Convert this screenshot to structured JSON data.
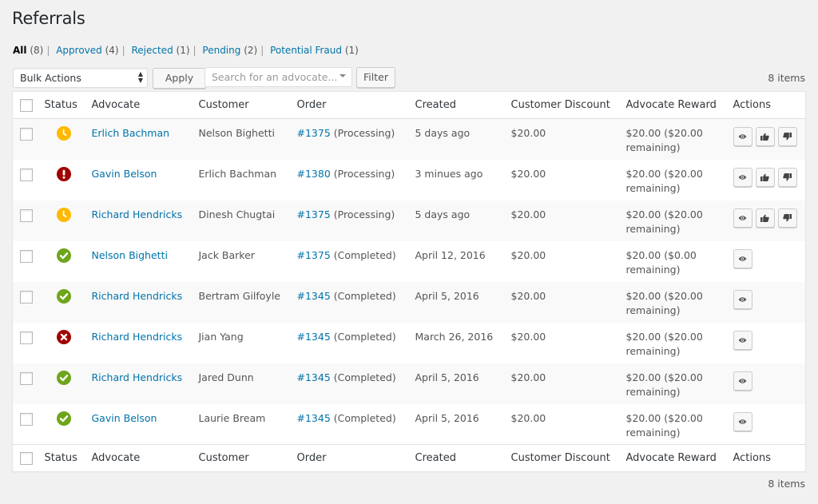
{
  "page": {
    "title": "Referrals"
  },
  "filters": [
    {
      "label": "All",
      "count": "(8)",
      "current": true
    },
    {
      "label": "Approved",
      "count": "(4)",
      "current": false
    },
    {
      "label": "Rejected",
      "count": "(1)",
      "current": false
    },
    {
      "label": "Pending",
      "count": "(2)",
      "current": false
    },
    {
      "label": "Potential Fraud",
      "count": "(1)",
      "current": false
    }
  ],
  "toolbar": {
    "bulk_actions": "Bulk Actions",
    "apply_label": "Apply",
    "search_placeholder": "Search for an advocate...",
    "filter_label": "Filter",
    "items_count": "8 items"
  },
  "columns": [
    "Status",
    "Advocate",
    "Customer",
    "Order",
    "Created",
    "Customer Discount",
    "Advocate Reward",
    "Actions"
  ],
  "status_colors": {
    "pending": "#ffb900",
    "fraud": "#a00000",
    "approved": "#6ea51b",
    "rejected": "#a00000"
  },
  "rows": [
    {
      "status": "pending",
      "advocate": "Erlich Bachman",
      "customer": "Nelson Bighetti",
      "order_number": "#1375",
      "order_status": "(Processing)",
      "created": "5 days ago",
      "discount": "$20.00",
      "reward": "$20.00 ($20.00 remaining)",
      "actions": [
        "view",
        "approve",
        "reject"
      ]
    },
    {
      "status": "fraud",
      "advocate": "Gavin Belson",
      "customer": "Erlich Bachman",
      "order_number": "#1380",
      "order_status": "(Processing)",
      "created": "3 minues ago",
      "discount": "$20.00",
      "reward": "$20.00 ($20.00 remaining)",
      "actions": [
        "view",
        "approve",
        "reject"
      ]
    },
    {
      "status": "pending",
      "advocate": "Richard Hendricks",
      "customer": "Dinesh Chugtai",
      "order_number": "#1375",
      "order_status": "(Processing)",
      "created": "5 days ago",
      "discount": "$20.00",
      "reward": "$20.00 ($20.00 remaining)",
      "actions": [
        "view",
        "approve",
        "reject"
      ]
    },
    {
      "status": "approved",
      "advocate": "Nelson Bighetti",
      "customer": "Jack Barker",
      "order_number": "#1375",
      "order_status": "(Completed)",
      "created": "April 12, 2016",
      "discount": "$20.00",
      "reward": "$20.00 ($0.00 remaining)",
      "actions": [
        "view"
      ]
    },
    {
      "status": "approved",
      "advocate": "Richard Hendricks",
      "customer": "Bertram Gilfoyle",
      "order_number": "#1345",
      "order_status": "(Completed)",
      "created": "April 5, 2016",
      "discount": "$20.00",
      "reward": "$20.00 ($20.00 remaining)",
      "actions": [
        "view"
      ]
    },
    {
      "status": "rejected",
      "advocate": "Richard Hendricks",
      "customer": "Jian Yang",
      "order_number": "#1345",
      "order_status": "(Completed)",
      "created": "March 26, 2016",
      "discount": "$20.00",
      "reward": "$20.00 ($20.00 remaining)",
      "actions": [
        "view"
      ]
    },
    {
      "status": "approved",
      "advocate": "Richard Hendricks",
      "customer": "Jared Dunn",
      "order_number": "#1345",
      "order_status": "(Completed)",
      "created": "April 5, 2016",
      "discount": "$20.00",
      "reward": "$20.00 ($20.00 remaining)",
      "actions": [
        "view"
      ]
    },
    {
      "status": "approved",
      "advocate": "Gavin Belson",
      "customer": "Laurie Bream",
      "order_number": "#1345",
      "order_status": "(Completed)",
      "created": "April 5, 2016",
      "discount": "$20.00",
      "reward": "$20.00 ($20.00 remaining)",
      "actions": [
        "view"
      ]
    }
  ]
}
